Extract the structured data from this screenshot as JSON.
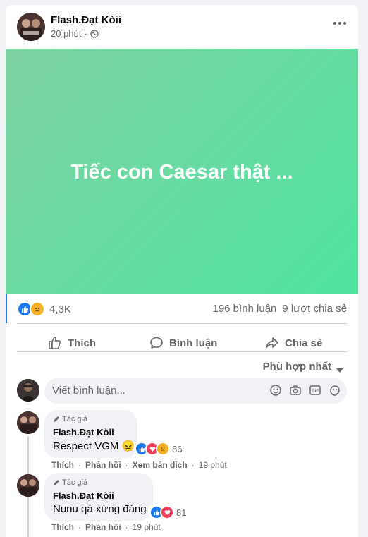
{
  "post": {
    "author": "Flash.Đạt Kòii",
    "time": "20 phút",
    "privacy_icon": "globe-icon",
    "background_text": "Tiếc con Caesar thật ...",
    "background_colors": [
      "#7fd2a4",
      "#4fe3a0"
    ],
    "reaction_count": "4,3K",
    "reactions": [
      "like",
      "sad"
    ],
    "comments_count": "196 bình luận",
    "shares_count": "9 lượt chia sẻ"
  },
  "actions": {
    "like": "Thích",
    "comment": "Bình luận",
    "share": "Chia sẻ"
  },
  "comments_sort": "Phù hợp nhất",
  "comment_input": {
    "placeholder": "Viết bình luận...",
    "icons": [
      "emoji-icon",
      "camera-icon",
      "gif-icon",
      "sticker-icon"
    ]
  },
  "comments": [
    {
      "tag": "Tác giả",
      "author": "Flash.Đạt Kòii",
      "text": "Respect VGM 😖",
      "reactions": [
        "like",
        "love",
        "sad"
      ],
      "reaction_count": "86",
      "actions": [
        "Thích",
        "Phản hồi",
        "Xem bản dịch"
      ],
      "time": "19 phút"
    },
    {
      "tag": "Tác giả",
      "author": "Flash.Đạt Kòii",
      "text": "Nunu qá xứng đáng",
      "reactions": [
        "like",
        "love"
      ],
      "reaction_count": "81",
      "actions": [
        "Thích",
        "Phản hồi"
      ],
      "time": "19 phút"
    }
  ],
  "colors": {
    "like": "#1877f2",
    "love": "#f33e58",
    "sad": "#f7b125",
    "muted_text": "#65676b"
  }
}
